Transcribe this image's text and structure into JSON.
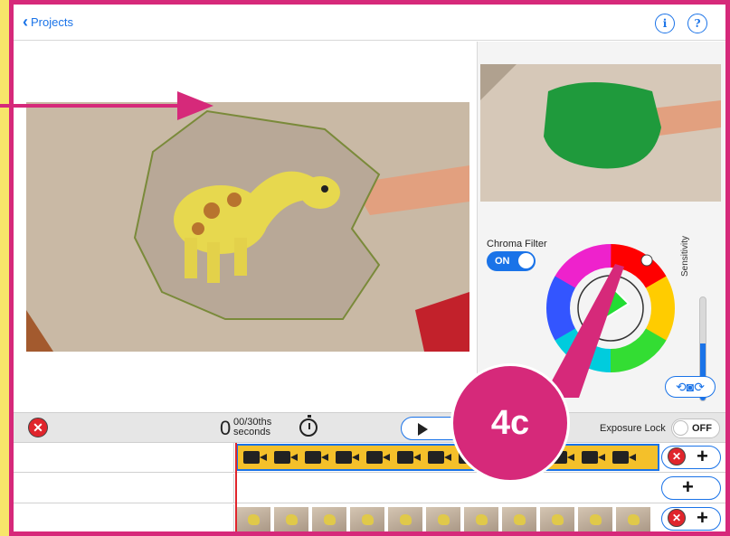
{
  "topbar": {
    "back_label": "Projects",
    "info_icon": "i",
    "help_icon": "?"
  },
  "chroma": {
    "label": "Chroma Filter",
    "toggle": "ON",
    "sensitivity_label": "Sensitivity",
    "sensitivity_level": 0.55
  },
  "timeline": {
    "frame_count": "0",
    "frames_per_second": "00/30ths",
    "unit": "seconds",
    "exposure_lock_label": "Exposure Lock",
    "exposure_toggle": "OFF"
  },
  "annotation": {
    "badge_text": "4c"
  },
  "colors": {
    "frame": "#d6297a",
    "accent": "#1a73e8",
    "strip": "#f4c02a"
  }
}
